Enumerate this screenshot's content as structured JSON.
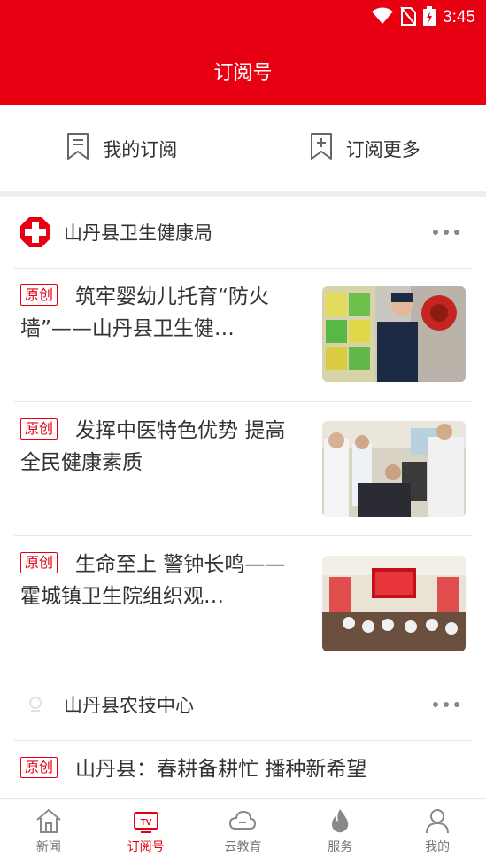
{
  "status_bar": {
    "time": "3:45"
  },
  "header": {
    "title": "订阅号"
  },
  "tabs": [
    {
      "label": "我的订阅",
      "icon": "bookmark-icon"
    },
    {
      "label": "订阅更多",
      "icon": "bookmark-add-icon"
    }
  ],
  "sections": [
    {
      "name": "山丹县卫生健康局",
      "articles": [
        {
          "badge": "原创",
          "title": "筑牢婴幼儿托育“防火墙”——山丹县卫生健…"
        },
        {
          "badge": "原创",
          "title": "发挥中医特色优势 提高全民健康素质"
        },
        {
          "badge": "原创",
          "title": "生命至上 警钟长鸣——霍城镇卫生院组织观…"
        }
      ]
    },
    {
      "name": "山丹县农技中心",
      "articles": [
        {
          "badge": "原创",
          "title": "山丹县：春耕备耕忙 播种新希望"
        }
      ]
    }
  ],
  "bottom_nav": [
    {
      "label": "新闻",
      "icon": "home-icon",
      "active": false
    },
    {
      "label": "订阅号",
      "icon": "tv-icon",
      "active": true
    },
    {
      "label": "云教育",
      "icon": "cloud-icon",
      "active": false
    },
    {
      "label": "服务",
      "icon": "flame-icon",
      "active": false
    },
    {
      "label": "我的",
      "icon": "user-icon",
      "active": false
    }
  ],
  "colors": {
    "brand": "#e60012",
    "text": "#333333",
    "muted": "#777777"
  }
}
